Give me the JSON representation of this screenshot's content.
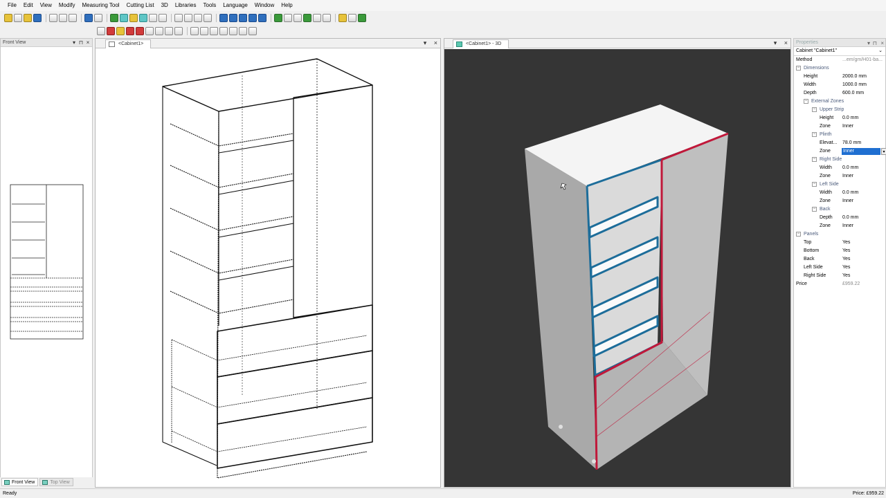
{
  "menu": [
    "File",
    "Edit",
    "View",
    "Modify",
    "Measuring Tool",
    "Cutting List",
    "3D",
    "Libraries",
    "Tools",
    "Language",
    "Window",
    "Help"
  ],
  "front_view_panel": {
    "title": "Front View"
  },
  "doc_left": {
    "tab_label": "<Cabinet1>"
  },
  "doc_right": {
    "tab_label": "<Cabinet1> - 3D"
  },
  "view_tabs": {
    "front": "Front View",
    "top": "Top View"
  },
  "properties": {
    "title": "Properties",
    "object": "Cabinet \"Cabinet1\"",
    "method": {
      "label": "Method",
      "value": "...em/gm/H01-ba..."
    },
    "dimensions": {
      "label": "Dimensions",
      "height": {
        "label": "Height",
        "value": "2000.0 mm"
      },
      "width": {
        "label": "Width",
        "value": "1000.0 mm"
      },
      "depth": {
        "label": "Depth",
        "value": "600.0 mm"
      }
    },
    "external_zones": {
      "label": "External Zones",
      "upper_strip": {
        "label": "Upper Strip",
        "height_label": "Height",
        "height_value": "0.0 mm",
        "zone_label": "Zone",
        "zone_value": "Inner"
      },
      "plinth": {
        "label": "Plinth",
        "elevation_label": "Elevat...",
        "elevation_value": "78.0 mm",
        "zone_label": "Zone",
        "zone_value": "Inner"
      },
      "right_side": {
        "label": "Right Side",
        "width_label": "Width",
        "width_value": "0.0 mm",
        "zone_label": "Zone",
        "zone_value": "Inner"
      },
      "left_side": {
        "label": "Left Side",
        "width_label": "Width",
        "width_value": "0.0 mm",
        "zone_label": "Zone",
        "zone_value": "Inner"
      },
      "back": {
        "label": "Back",
        "depth_label": "Depth",
        "depth_value": "0.0 mm",
        "zone_label": "Zone",
        "zone_value": "Inner"
      }
    },
    "panels": {
      "label": "Panels",
      "top": {
        "label": "Top",
        "value": "Yes"
      },
      "bottom": {
        "label": "Bottom",
        "value": "Yes"
      },
      "back": {
        "label": "Back",
        "value": "Yes"
      },
      "left_side": {
        "label": "Left Side",
        "value": "Yes"
      },
      "right_side": {
        "label": "Right Side",
        "value": "Yes"
      }
    },
    "price": {
      "label": "Price",
      "value": "£959.22"
    }
  },
  "status": {
    "left": "Ready",
    "right": "Price: £959.22"
  },
  "colors": {
    "accent_blue": "#1f6fd1",
    "edge_blue": "#1d6d9a",
    "edge_red": "#c0183a",
    "viewport_bg": "#353535"
  }
}
